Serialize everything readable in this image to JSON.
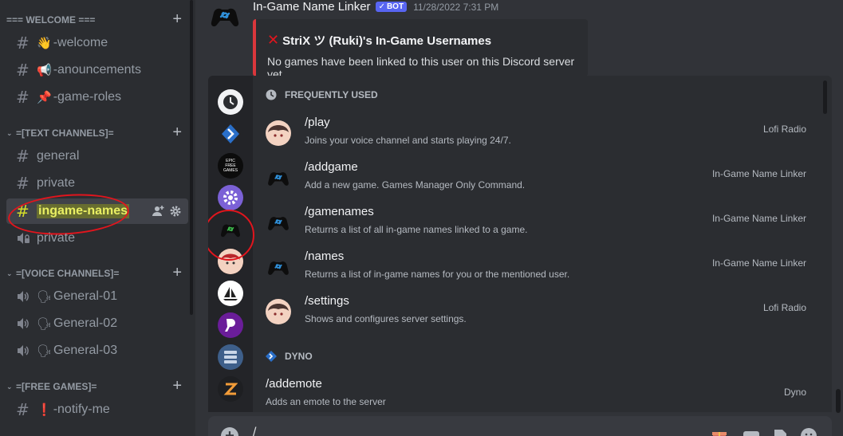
{
  "sidebar": {
    "categories": [
      {
        "label": "=== WELCOME ===",
        "channels": [
          {
            "emoji": "👋",
            "name": "-welcome"
          },
          {
            "emoji": "📢",
            "name": "-anouncements"
          },
          {
            "emoji": "📌",
            "name": "-game-roles"
          }
        ]
      },
      {
        "label": "=[TEXT CHANNELS]=",
        "channels": [
          {
            "name": "general"
          },
          {
            "name": "private"
          },
          {
            "name": "ingame-names"
          },
          {
            "name": "private"
          }
        ]
      },
      {
        "label": "=[VOICE CHANNELS]=",
        "channels": [
          {
            "emoji": "🗣",
            "name": "General-01"
          },
          {
            "emoji": "🗣",
            "name": "General-02"
          },
          {
            "emoji": "🗣",
            "name": "General-03"
          }
        ]
      },
      {
        "label": "=[FREE GAMES]=",
        "channels": [
          {
            "emoji": "❗",
            "name": "-notify-me"
          }
        ]
      }
    ]
  },
  "message": {
    "author": "In-Game Name Linker",
    "badge": "BOT",
    "timestamp": "11/28/2022 7:31 PM",
    "embed": {
      "title": "StriX ツ (Ruki)'s In-Game Usernames",
      "description": "No games have been linked to this user on this Discord server yet.",
      "accent_color": "#da373c"
    }
  },
  "commands": {
    "sections": [
      {
        "header": "FREQUENTLY USED",
        "items": [
          {
            "name": "/play",
            "desc": "Joins your voice channel and starts playing 24/7.",
            "source": "Lofi Radio",
            "avatar": "anime-avatar"
          },
          {
            "name": "/addgame",
            "desc": "Add a new game. Games Manager Only Command.",
            "source": "In-Game Name Linker",
            "avatar": "controller-link-avatar"
          },
          {
            "name": "/gamenames",
            "desc": "Returns a list of all in-game names linked to a game.",
            "source": "In-Game Name Linker",
            "avatar": "controller-link-avatar"
          },
          {
            "name": "/names",
            "desc": "Returns a list of in-game names for you or the mentioned user.",
            "source": "In-Game Name Linker",
            "avatar": "controller-link-avatar"
          },
          {
            "name": "/settings",
            "desc": "Shows and configures server settings.",
            "source": "Lofi Radio",
            "avatar": "anime-avatar"
          }
        ]
      },
      {
        "header": "DYNO",
        "items": [
          {
            "name": "/addemote",
            "desc": "Adds an emote to the server",
            "source": "Dyno"
          }
        ]
      }
    ],
    "rail": [
      "clock-icon",
      "dyno-icon",
      "epic-free-games-icon",
      "gear-bot-icon",
      "controller-link-icon",
      "anime-avatar-icon",
      "sailboat-icon",
      "p-logo-icon",
      "server-list-icon",
      "z-logo-icon"
    ],
    "epic_label": "EPIC FREE GAMES"
  },
  "input": {
    "text": "/"
  }
}
